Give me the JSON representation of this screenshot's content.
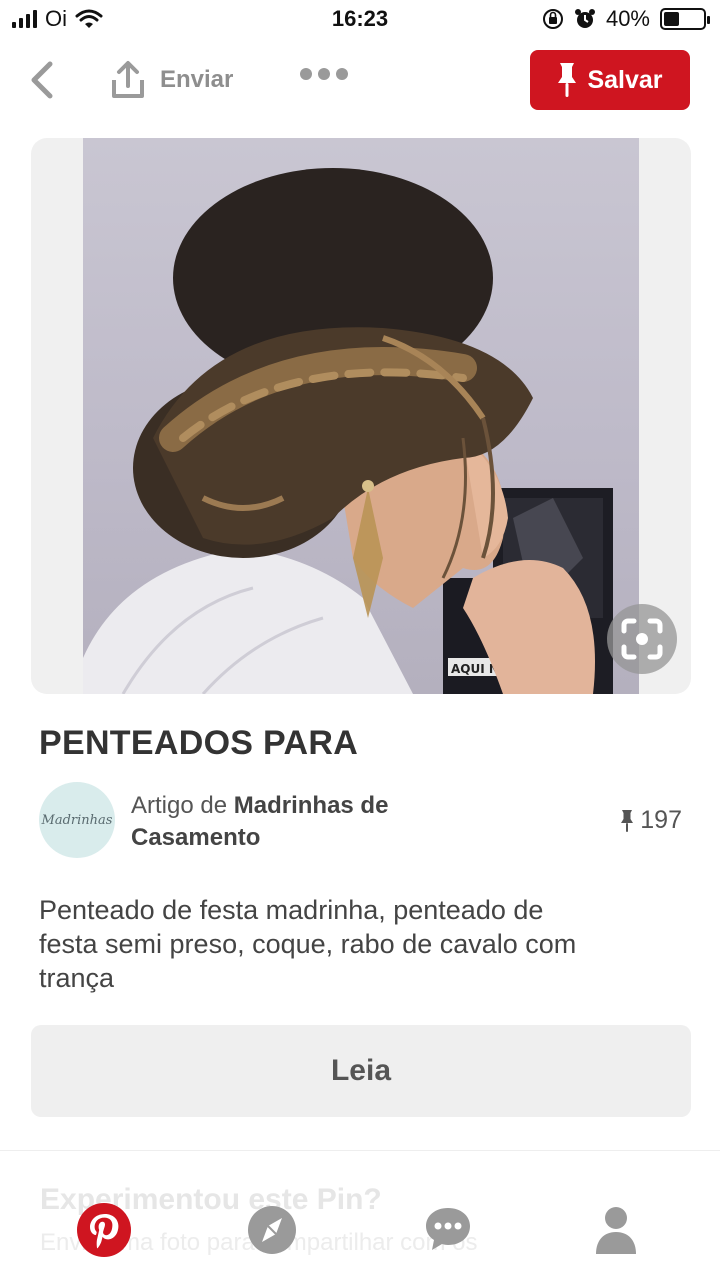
{
  "status_bar": {
    "carrier": "Oi",
    "time": "16:23",
    "battery_percent": "40%",
    "battery_level": 0.4
  },
  "toolbar": {
    "share_label": "Enviar",
    "save_label": "Salvar",
    "save_color": "#cf1520"
  },
  "pin": {
    "title": "PENTEADOS PARA",
    "avatar_text": "Madrinhas",
    "source_prefix": "Artigo de",
    "source_name": "Madrinhas de Casamento",
    "save_count": "197",
    "description": "Penteado de festa madrinha, penteado de festa semi preso, coque, rabo de cavalo com trança",
    "read_label": "Leia",
    "photo_caption": "AQUI NÓS"
  },
  "faded": {
    "title": "Experimentou este Pin?",
    "subtitle": "Envie uma foto para compartilhar com os"
  },
  "tabs": [
    {
      "name": "home",
      "icon": "pinterest-logo-icon"
    },
    {
      "name": "explore",
      "icon": "compass-icon"
    },
    {
      "name": "notifications",
      "icon": "chat-bubble-icon"
    },
    {
      "name": "profile",
      "icon": "user-icon"
    }
  ]
}
